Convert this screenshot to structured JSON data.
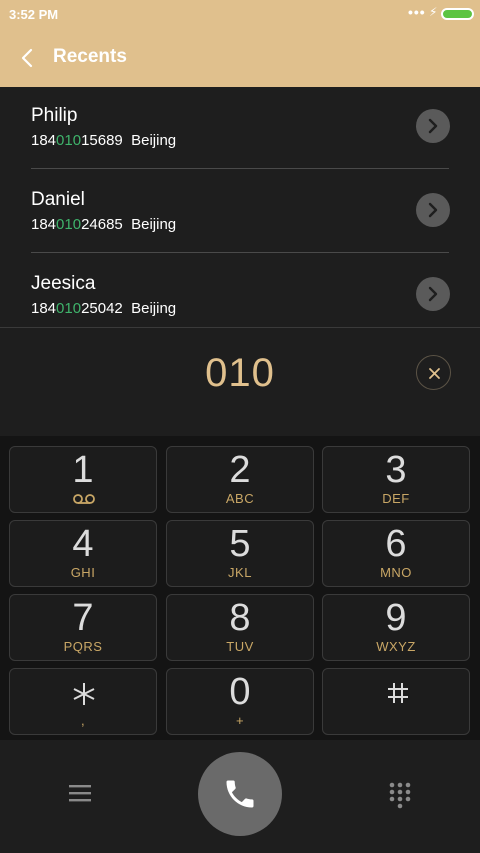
{
  "status": {
    "time": "3:52 PM",
    "dots": "•••",
    "bolt": "⚡"
  },
  "appbar": {
    "title": "Recents"
  },
  "contacts": [
    {
      "name": "Philip",
      "number_prefix": "184",
      "number_match": "010",
      "number_suffix": "15689",
      "location": "Beijing"
    },
    {
      "name": "Daniel",
      "number_prefix": "184",
      "number_match": "010",
      "number_suffix": "24685",
      "location": "Beijing"
    },
    {
      "name": "Jeesica",
      "number_prefix": "184",
      "number_match": "010",
      "number_suffix": "25042",
      "location": "Beijing"
    }
  ],
  "entry": {
    "number": "010"
  },
  "keypad": [
    {
      "digit": "1",
      "letters": ""
    },
    {
      "digit": "2",
      "letters": "ABC"
    },
    {
      "digit": "3",
      "letters": "DEF"
    },
    {
      "digit": "4",
      "letters": "GHI"
    },
    {
      "digit": "5",
      "letters": "JKL"
    },
    {
      "digit": "6",
      "letters": "MNO"
    },
    {
      "digit": "7",
      "letters": "PQRS"
    },
    {
      "digit": "8",
      "letters": "TUV"
    },
    {
      "digit": "9",
      "letters": "WXYZ"
    },
    {
      "digit": "",
      "letters": ","
    },
    {
      "digit": "0",
      "letters": "+"
    },
    {
      "digit": "",
      "letters": ""
    }
  ],
  "colors": {
    "accent": "#e0c08d",
    "match": "#3fb36b",
    "battery": "#5cc443"
  },
  "icons": {
    "voicemail": "voicemail-icon",
    "star": "star-key-icon",
    "pound": "pound-key-icon",
    "call": "phone-icon",
    "menu": "menu-icon",
    "dialpad": "dialpad-icon"
  }
}
